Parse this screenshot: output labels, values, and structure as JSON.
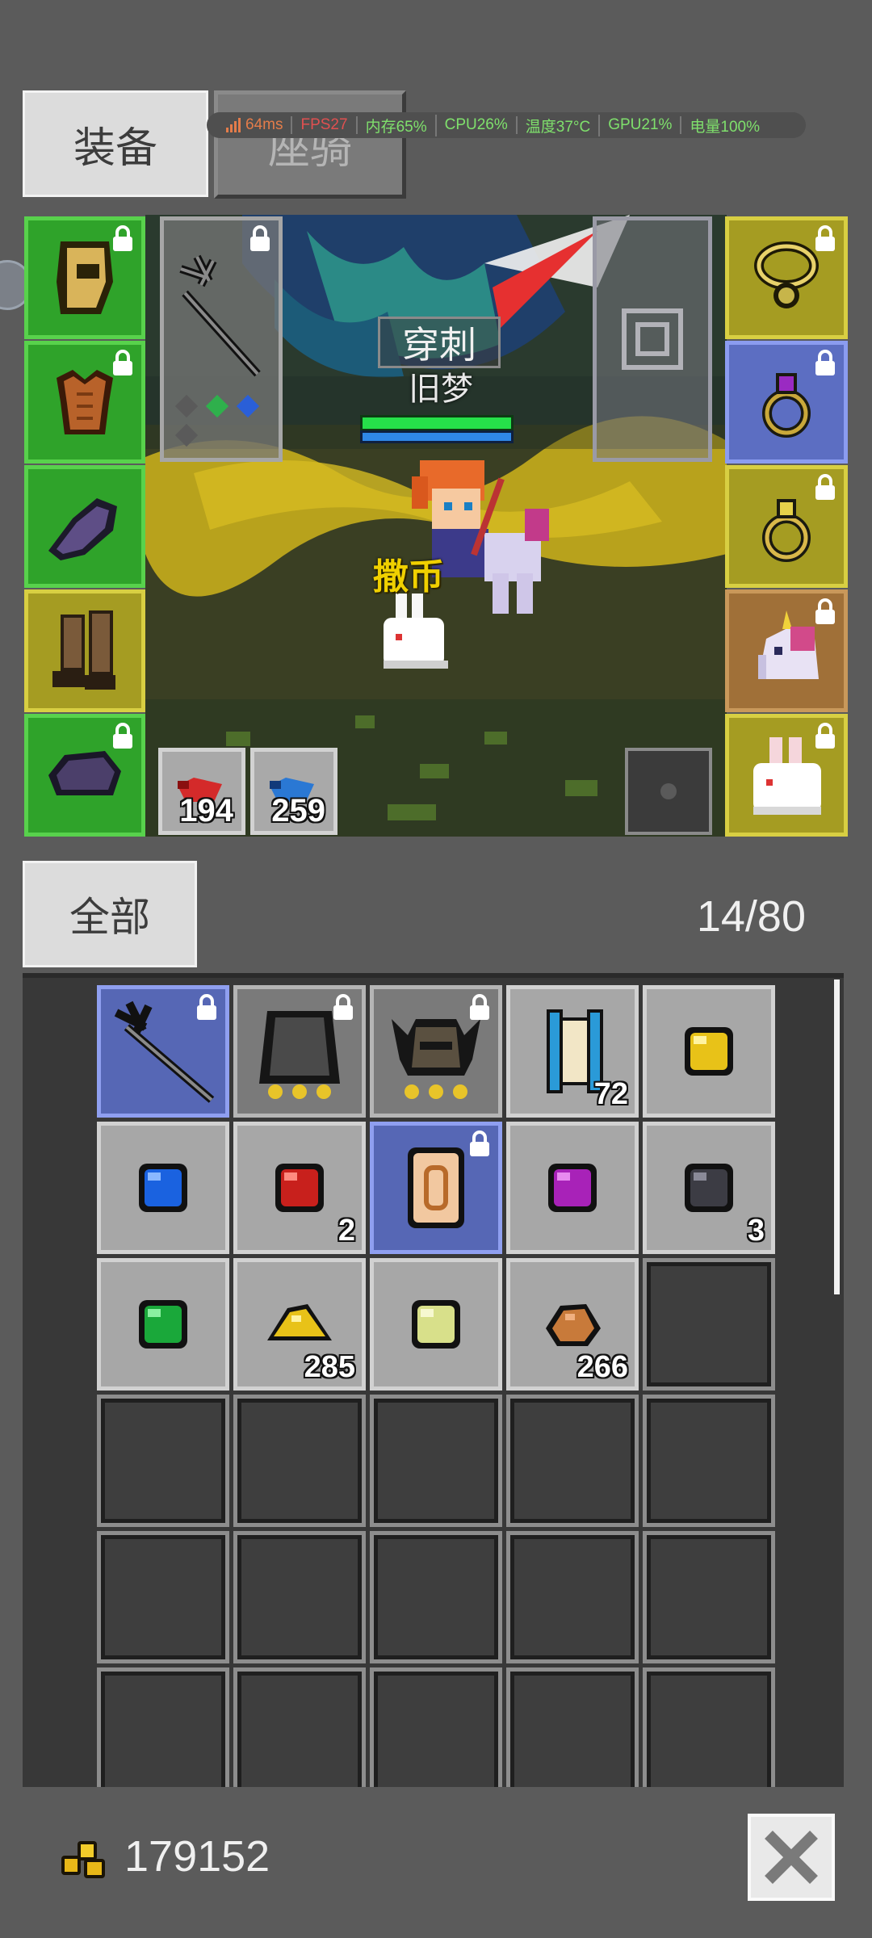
{
  "tabs": {
    "equipment": "装备",
    "mount": "座骑"
  },
  "perf": {
    "latency": "64ms",
    "fps": "FPS27",
    "memory": "内存65%",
    "cpu": "CPU26%",
    "temp": "温度37°C",
    "gpu": "GPU21%",
    "battery": "电量100%"
  },
  "scene": {
    "skill_name": "穿刺",
    "player_name": "旧梦",
    "pet_label": "撒币",
    "hp_potions": "194",
    "mp_potions": "259"
  },
  "filter": {
    "label": "全部",
    "capacity": "14/80"
  },
  "inventory": [
    {
      "name": "trident-weapon-icon",
      "count": "",
      "locked": true
    },
    {
      "name": "dark-cape-icon",
      "count": "",
      "locked": true
    },
    {
      "name": "horned-helmet-icon",
      "count": "",
      "locked": true
    },
    {
      "name": "scroll-icon",
      "count": "72",
      "locked": false
    },
    {
      "name": "yellow-gem-icon",
      "count": "",
      "locked": false
    },
    {
      "name": "blue-gem-icon",
      "count": "",
      "locked": false
    },
    {
      "name": "red-gem-icon",
      "count": "2",
      "locked": false
    },
    {
      "name": "rune-stone-icon",
      "count": "",
      "locked": true
    },
    {
      "name": "purple-gem-icon",
      "count": "",
      "locked": false
    },
    {
      "name": "black-gem-icon",
      "count": "3",
      "locked": false
    },
    {
      "name": "green-gem-icon",
      "count": "",
      "locked": false
    },
    {
      "name": "gold-ore-icon",
      "count": "285",
      "locked": false
    },
    {
      "name": "light-green-gem-icon",
      "count": "",
      "locked": false
    },
    {
      "name": "copper-ore-icon",
      "count": "266",
      "locked": false
    }
  ],
  "gold": "179152",
  "colors": {
    "background": "#5b5b5b",
    "slot_green": "#2fa32a",
    "slot_yellow": "#a59c22",
    "slot_blue": "#5c6ec2",
    "text_light": "#f0f0f0"
  }
}
